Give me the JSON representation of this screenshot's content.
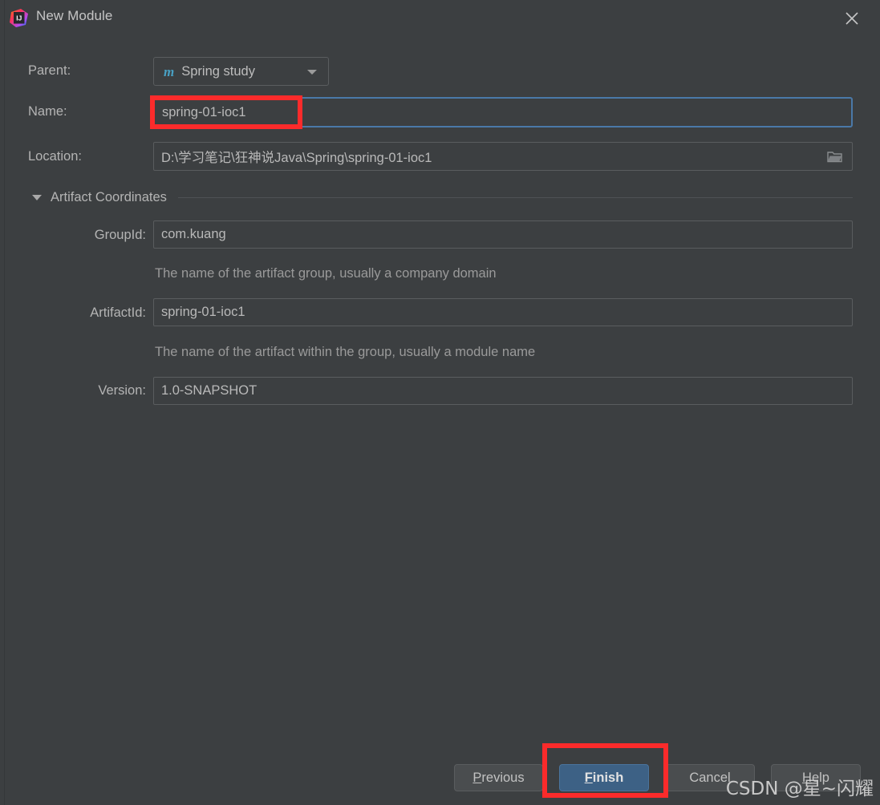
{
  "window": {
    "title": "New Module",
    "app_icon": "intellij-idea-logo",
    "close_icon": "close-icon"
  },
  "form": {
    "parent": {
      "label": "Parent:",
      "value": "Spring study",
      "icon": "maven-module-icon",
      "dropdown_icon": "chevron-down-icon"
    },
    "name": {
      "label": "Name:",
      "value": "spring-01-ioc1",
      "focused": true
    },
    "location": {
      "label": "Location:",
      "value": "D:\\学习笔记\\狂神说Java\\Spring\\spring-01-ioc1",
      "browse_icon": "folder-icon"
    }
  },
  "artifact_coordinates": {
    "section_title": "Artifact Coordinates",
    "expanded": true,
    "collapse_icon": "triangle-down-icon",
    "fields": [
      {
        "label": "GroupId:",
        "value": "com.kuang",
        "hint": "The name of the artifact group, usually a company domain"
      },
      {
        "label": "ArtifactId:",
        "value": "spring-01-ioc1",
        "hint": "The name of the artifact within the group, usually a module name"
      },
      {
        "label": "Version:",
        "value": "1.0-SNAPSHOT",
        "hint": ""
      }
    ]
  },
  "buttons": {
    "previous": {
      "mnemonic": "P",
      "rest": "revious"
    },
    "finish": {
      "mnemonic": "F",
      "rest": "inish"
    },
    "cancel": {
      "label": "Cancel"
    },
    "help": {
      "mnemonic": "H",
      "rest": "elp"
    }
  },
  "annotations": {
    "highlight_color": "#fb2b2b",
    "targets": [
      "name-field",
      "finish-button"
    ]
  },
  "watermark": {
    "text": "CSDN @星~闪耀"
  },
  "colors": {
    "dialog_background": "#3c3f41",
    "field_border": "#5a5d5f",
    "focus_border": "#4a79a8",
    "primary_button": "#3d6185",
    "maven_icon": "#48a1c4",
    "text": "#b4b4b4",
    "hint_text": "#9a9a9a"
  }
}
